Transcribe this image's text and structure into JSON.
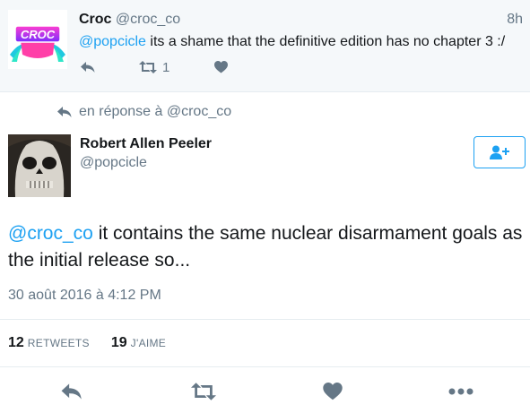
{
  "parent_tweet": {
    "name": "Croc",
    "handle": "@croc_co",
    "time": "8h",
    "mention": "@popcicle",
    "text": " its a shame that the definitive edition has no chapter 3 :/",
    "avatar_text": "CROC",
    "retweet_count": "1"
  },
  "reply_context": {
    "prefix": "en réponse à ",
    "handle": "@croc_co"
  },
  "main_tweet": {
    "name": "Robert Allen Peeler",
    "handle": "@popcicle",
    "mention": "@croc_co",
    "text": " it contains the same nuclear disarmament goals as the initial release so...",
    "date": "30 août 2016 à 4:12 PM",
    "retweets_count": "12",
    "retweets_label": "RETWEETS",
    "likes_count": "19",
    "likes_label": "J'AIME"
  },
  "colors": {
    "link": "#1da1f2",
    "muted": "#657786",
    "parent_bg": "#f5f8fa"
  },
  "icons": [
    "reply-icon",
    "retweet-icon",
    "like-icon",
    "follow-icon",
    "more-icon"
  ]
}
